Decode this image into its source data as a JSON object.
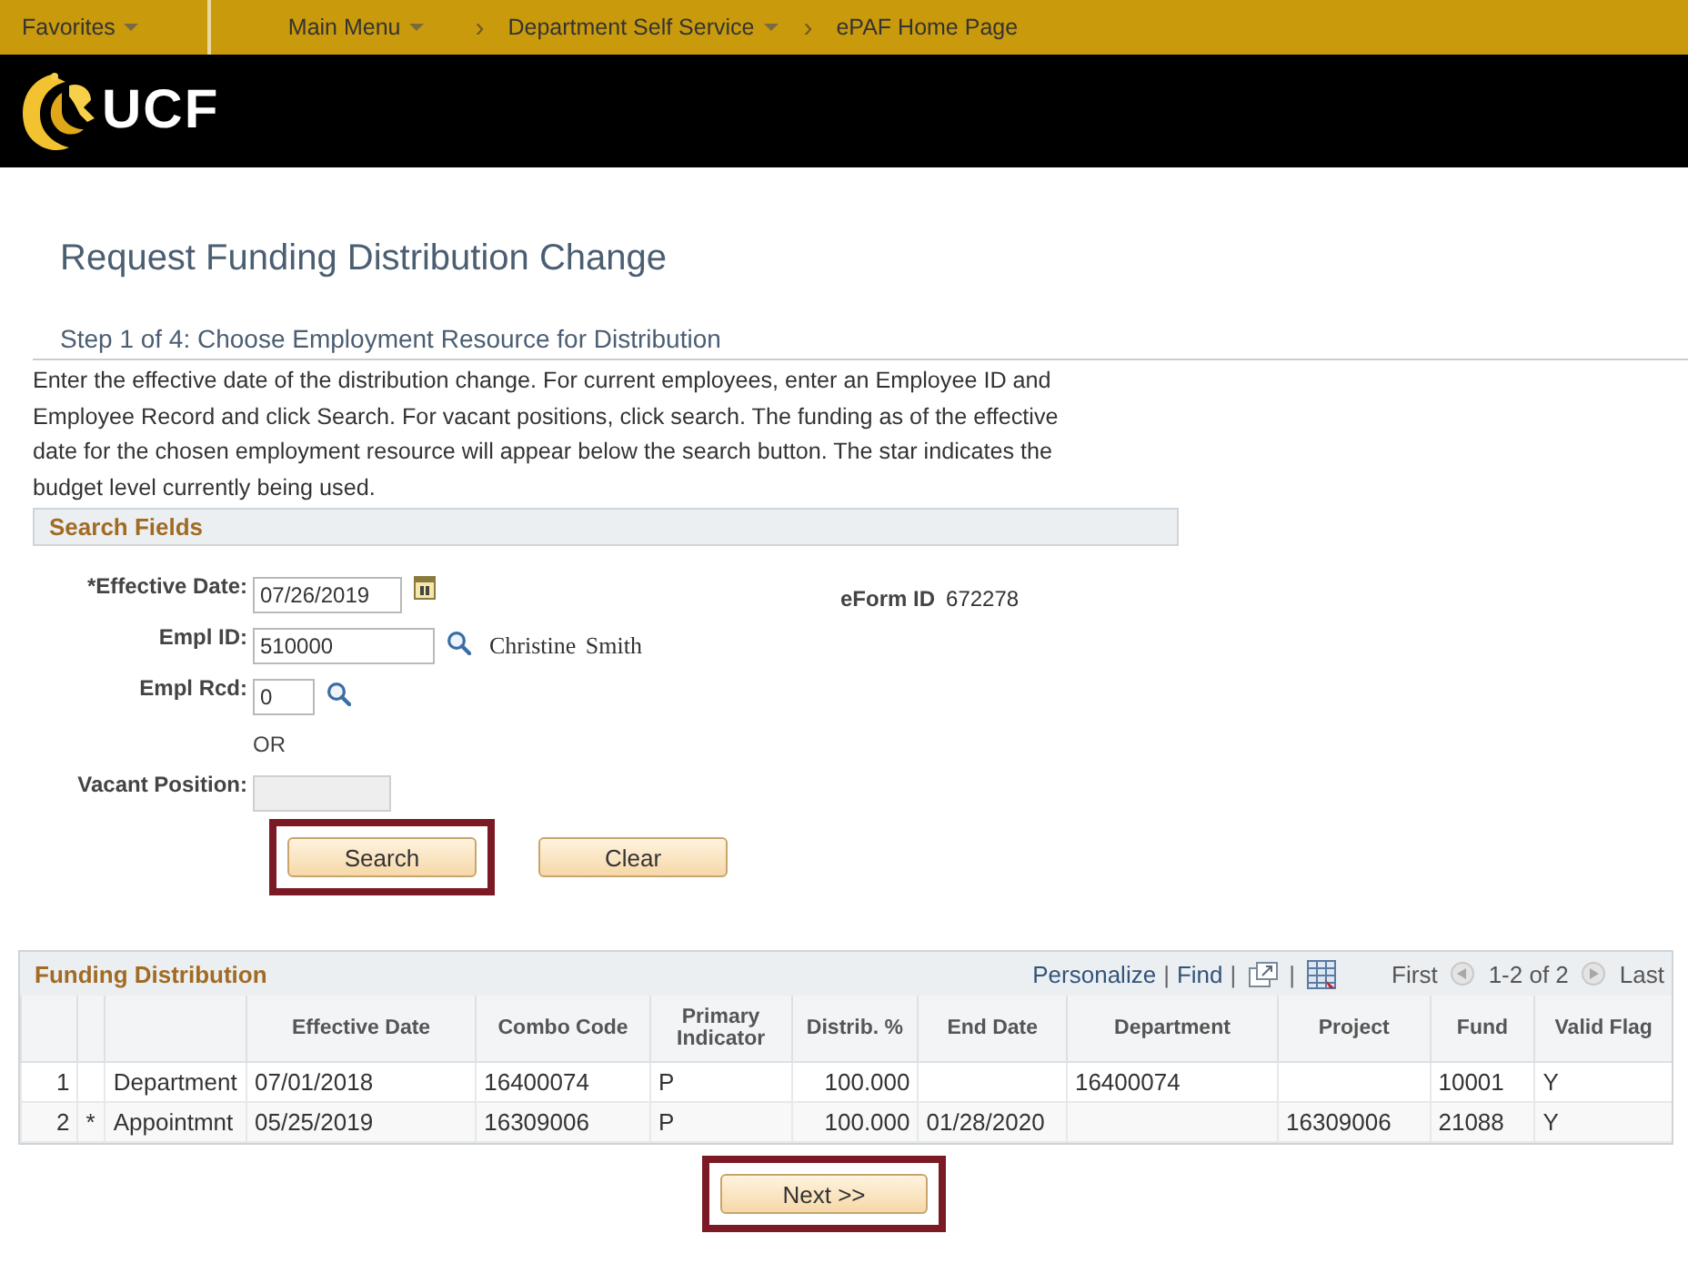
{
  "nav": {
    "items": [
      {
        "label": "Favorites",
        "dropdown": true
      },
      {
        "label": "Main Menu",
        "dropdown": true
      },
      {
        "label": "Department Self Service",
        "dropdown": true,
        "separator": "›"
      },
      {
        "label": "ePAF Home Page",
        "dropdown": false,
        "separator": "›"
      }
    ]
  },
  "header": {
    "logo_text": "UCF"
  },
  "page_title": "Request Funding Distribution Change",
  "step_title": "Step 1 of 4: Choose Employment Resource for Distribution",
  "instructions": "Enter the effective date of the distribution change. For current employees, enter an Employee ID and Employee Record and click Search. For vacant positions, click search. The funding as of the effective date for the chosen employment resource will appear below the search button. The star indicates the budget level currently being used.",
  "search_fields": {
    "title": "Search Fields",
    "effective_date": {
      "label": "*Effective Date:",
      "value": "07/26/2019"
    },
    "eform_id": {
      "label": "eForm ID",
      "value": "672278"
    },
    "empl_id": {
      "label": "Empl ID:",
      "value": "510000",
      "name": "Christine  Smith"
    },
    "empl_rcd": {
      "label": "Empl Rcd:",
      "value": "0"
    },
    "or_text": "OR",
    "vacant_position": {
      "label": "Vacant Position:",
      "disabled": true
    }
  },
  "buttons": [
    {
      "label": "Search",
      "highlighted": true
    },
    {
      "label": "Clear",
      "highlighted": false
    }
  ],
  "funding": {
    "title": "Funding Distribution",
    "links": [
      "Personalize",
      "Find"
    ],
    "separators": "|",
    "first": "First",
    "range": "1-2 of 2",
    "last": "Last",
    "columns": [
      "Effective Date",
      "Combo Code",
      "Primary Indicator",
      "Distrib. %",
      "End Date",
      "Department",
      "Project",
      "Fund",
      "Valid Flag"
    ],
    "rows": [
      {
        "number": "1",
        "marker": null,
        "type": "Department",
        "cells": [
          "07/01/2018",
          "16400074",
          "P",
          "100.000",
          null,
          "16400074",
          null,
          "10001",
          "Y"
        ]
      },
      {
        "number": "2",
        "marker": "*",
        "type": "Appointmnt",
        "cells": [
          "05/25/2019",
          "16309006",
          "P",
          "100.000",
          "01/28/2020",
          null,
          "16309006",
          "21088",
          "Y"
        ]
      }
    ]
  },
  "next_button": {
    "label": "Next >>",
    "highlighted": true
  }
}
